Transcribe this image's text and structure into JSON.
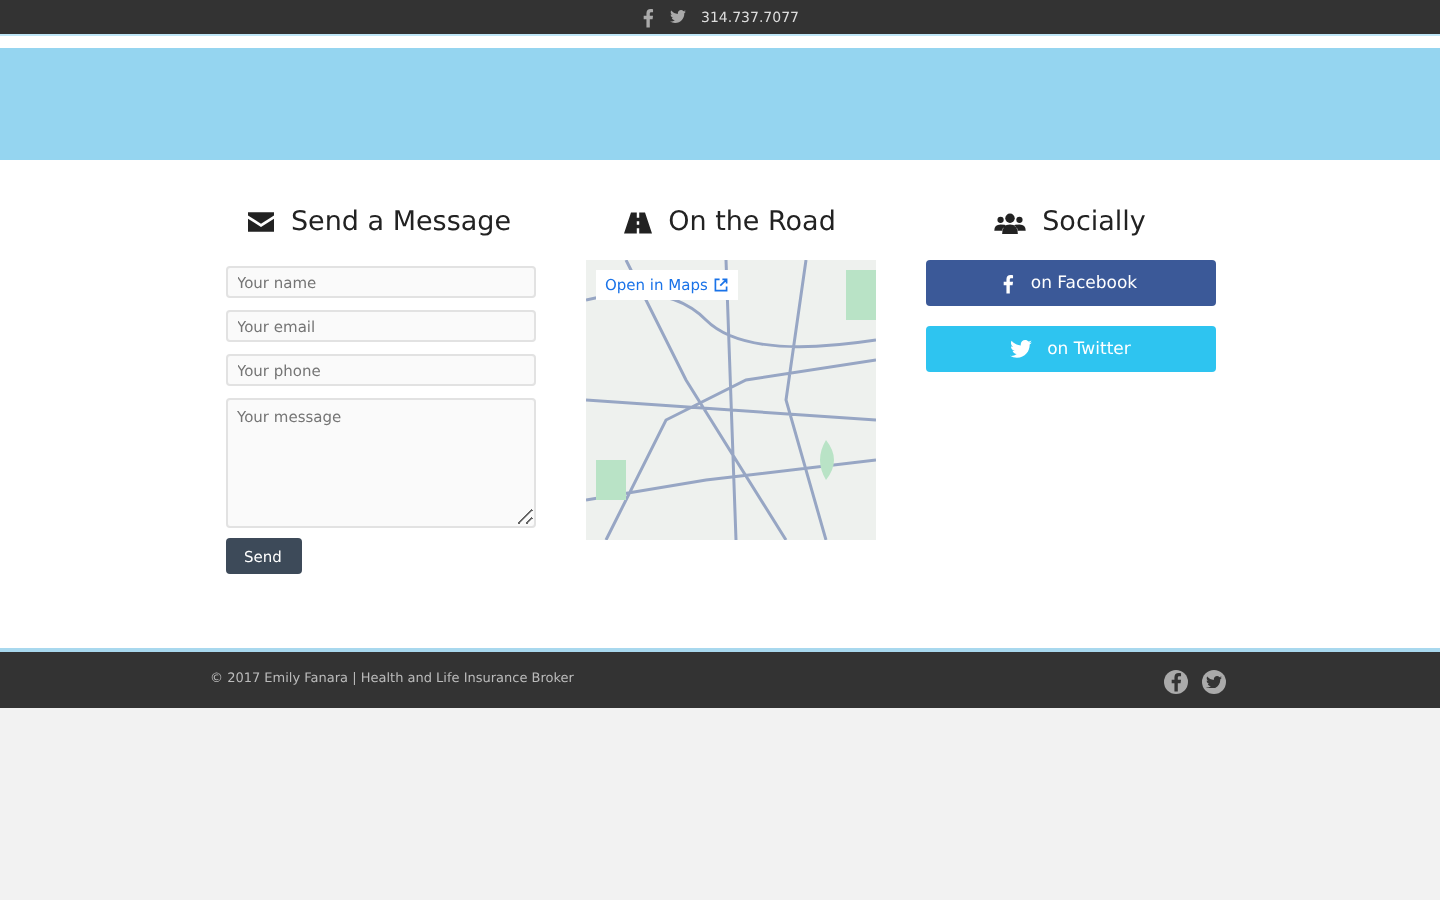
{
  "top_bar": {
    "phone": "314.737.7077"
  },
  "contact": {
    "title": "Send a Message",
    "fields": [
      {
        "placeholder": "Your name"
      },
      {
        "placeholder": "Your email"
      },
      {
        "placeholder": "Your phone"
      }
    ],
    "message": {
      "placeholder": "Your message"
    },
    "button": "Send"
  },
  "road": {
    "title": "On the Road",
    "map_link": "Open in Maps"
  },
  "social": {
    "title": "Socially",
    "buttons": [
      {
        "kind": "facebook",
        "label": "on Facebook"
      },
      {
        "kind": "twitter",
        "label": "on Twitter"
      }
    ]
  },
  "footer": {
    "text": "© 2017 Emily Fanara | Health and Life Insurance Broker"
  }
}
